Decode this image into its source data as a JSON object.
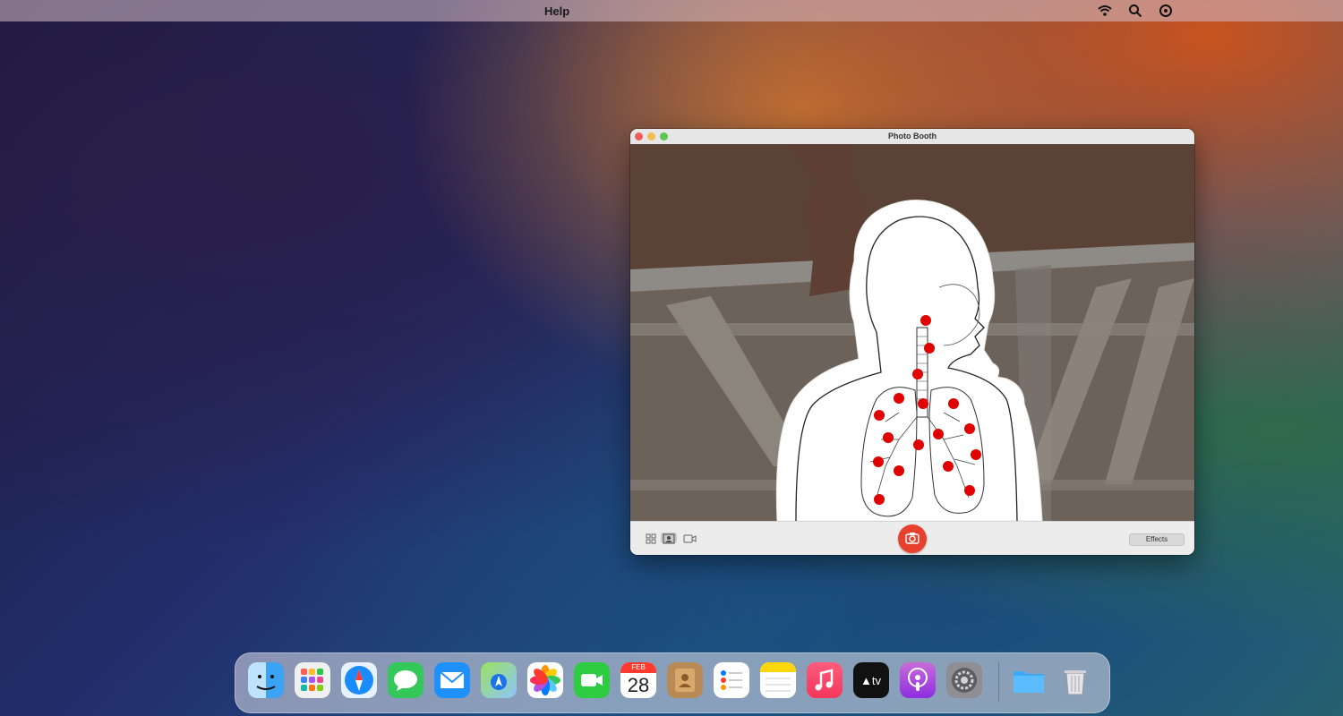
{
  "menubar": {
    "help_label": "Help"
  },
  "window": {
    "title": "Photo Booth",
    "effects_label": "Effects"
  },
  "calendar": {
    "month": "FEB",
    "day": "28"
  },
  "dock": {
    "apps": [
      {
        "name": "Finder",
        "icon": "finder-icon"
      },
      {
        "name": "Launchpad",
        "icon": "launchpad-icon"
      },
      {
        "name": "Safari",
        "icon": "safari-icon"
      },
      {
        "name": "Messages",
        "icon": "messages-icon"
      },
      {
        "name": "Mail",
        "icon": "mail-icon"
      },
      {
        "name": "Maps",
        "icon": "maps-icon"
      },
      {
        "name": "Photos",
        "icon": "photos-icon"
      },
      {
        "name": "FaceTime",
        "icon": "facetime-icon"
      },
      {
        "name": "Calendar",
        "icon": "calendar-icon"
      },
      {
        "name": "Contacts",
        "icon": "contacts-icon"
      },
      {
        "name": "Reminders",
        "icon": "reminders-icon"
      },
      {
        "name": "Notes",
        "icon": "notes-icon"
      },
      {
        "name": "Music",
        "icon": "music-icon"
      },
      {
        "name": "TV",
        "icon": "tv-icon"
      },
      {
        "name": "Podcasts",
        "icon": "podcasts-icon"
      },
      {
        "name": "System Preferences",
        "icon": "settings-icon"
      },
      {
        "name": "Downloads",
        "icon": "folder-icon"
      },
      {
        "name": "Trash",
        "icon": "trash-icon"
      }
    ]
  },
  "colors": {
    "capture_button": "#e8402c",
    "point_red": "#e00000"
  }
}
